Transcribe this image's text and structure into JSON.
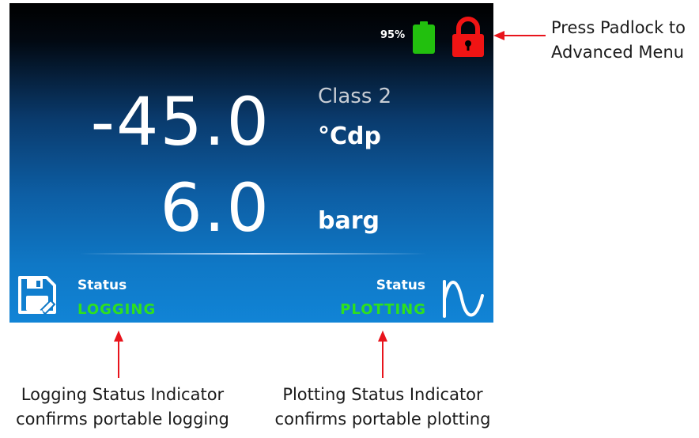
{
  "header": {
    "battery_percent": "95%",
    "battery_color": "#22c00e",
    "lock_color": "#f01414"
  },
  "readings": {
    "temperature": {
      "value": "-45.0",
      "class_label": "Class 2",
      "unit": "°Cdp"
    },
    "pressure": {
      "value": "6.0",
      "unit": "barg"
    }
  },
  "status": {
    "logging": {
      "label": "Status",
      "value": "LOGGING",
      "icon": "floppy-disk-icon"
    },
    "plotting": {
      "label": "Status",
      "value": "PLOTTING",
      "icon": "waveform-icon"
    },
    "active_color": "#2ee01e"
  },
  "annotations": {
    "padlock": [
      "Press Padlock to",
      "Advanced Menu"
    ],
    "logging": [
      "Logging Status Indicator",
      "confirms portable logging"
    ],
    "plotting": [
      "Plotting Status Indicator",
      "confirms portable plotting"
    ],
    "arrow_color": "#e8141c"
  }
}
